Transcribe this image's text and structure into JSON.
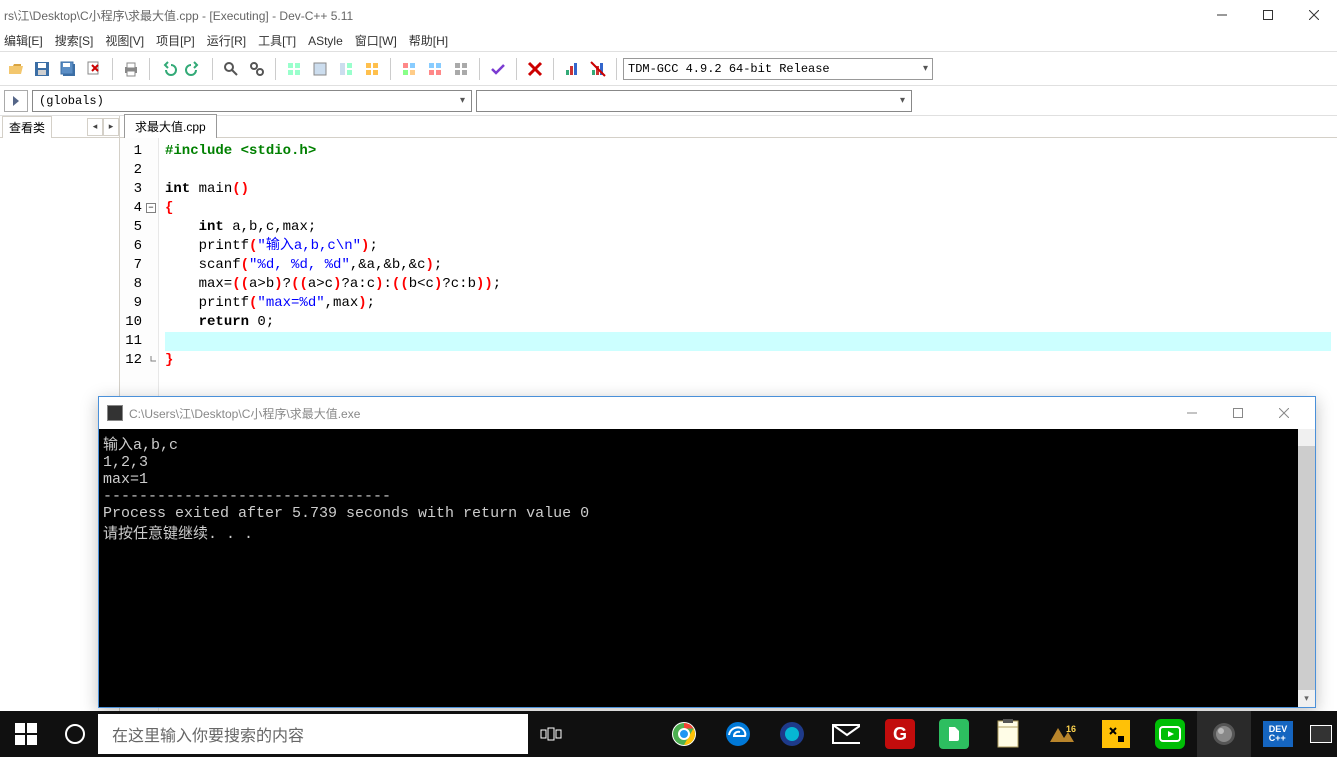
{
  "mainWindow": {
    "titlebar": "rs\\江\\Desktop\\C小程序\\求最大值.cpp - [Executing] - Dev-C++ 5.11"
  },
  "menu": {
    "edit": "编辑[E]",
    "search": "搜索[S]",
    "view": "视图[V]",
    "project": "项目[P]",
    "run": "运行[R]",
    "tools": "工具[T]",
    "astyle": "AStyle",
    "window": "窗口[W]",
    "help": "帮助[H]"
  },
  "toolbar": {
    "compilerCombo": "TDM-GCC 4.9.2 64-bit Release"
  },
  "classbar": {
    "scope": "(globals)"
  },
  "classPanel": {
    "tab": "查看类"
  },
  "fileTabs": {
    "active": "求最大值.cpp"
  },
  "code": {
    "lines": [
      {
        "n": "1",
        "html": "<span class=pp>#include</span> <span class=pp>&lt;stdio.h&gt;</span>"
      },
      {
        "n": "2",
        "html": ""
      },
      {
        "n": "3",
        "html": "<span class=kw>int</span> main<span class=br>()</span>"
      },
      {
        "n": "4",
        "html": "<span class=br>{</span>"
      },
      {
        "n": "5",
        "html": "    <span class=kw>int</span> a,b,c,max;"
      },
      {
        "n": "6",
        "html": "    printf<span class=br>(</span><span class=st>\"输入a,b,c\\n\"</span><span class=br>)</span>;"
      },
      {
        "n": "7",
        "html": "    scanf<span class=br>(</span><span class=st>\"%d, %d, %d\"</span>,&a,&b,&c<span class=br>)</span>;"
      },
      {
        "n": "8",
        "html": "    max=<span class=br>((</span>a&gt;b<span class=br>)</span>?<span class=br>((</span>a&gt;c<span class=br>)</span>?a:c<span class=br>)</span>:<span class=br>((</span>b&lt;c<span class=br>)</span>?c:b<span class=br>))</span>;"
      },
      {
        "n": "9",
        "html": "    printf<span class=br>(</span><span class=st>\"max=%d\"</span>,max<span class=br>)</span>;"
      },
      {
        "n": "10",
        "html": "    <span class=kw>return</span> 0;"
      },
      {
        "n": "11",
        "html": ""
      },
      {
        "n": "12",
        "html": "<span class=br>}</span>"
      }
    ]
  },
  "console": {
    "title": "C:\\Users\\江\\Desktop\\C小程序\\求最大值.exe",
    "output": "输入a,b,c\n1,2,3\nmax=1\n--------------------------------\nProcess exited after 5.739 seconds with return value 0\n请按任意键继续. . ."
  },
  "taskbar": {
    "searchPlaceholder": "在这里输入你要搜索的内容"
  }
}
